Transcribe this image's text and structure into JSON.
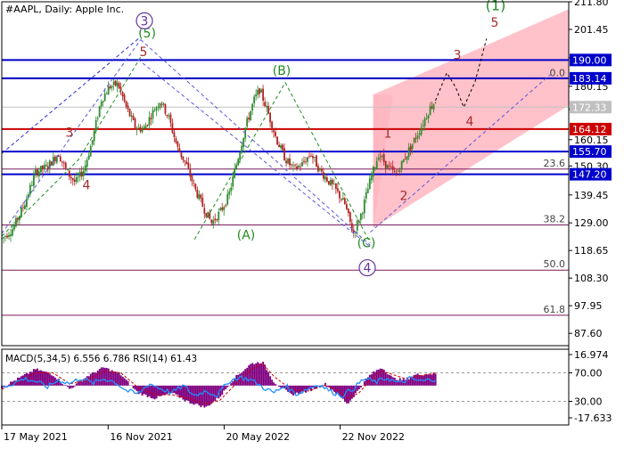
{
  "chart_data": [
    {
      "type": "candlestick",
      "title": "#AAPL, Daily:  Apple Inc.",
      "y_axis_ticks": [
        211.8,
        201.45,
        190.8,
        180.15,
        171.5,
        160.15,
        150.3,
        139.45,
        129.0,
        118.65,
        108.3,
        97.95,
        87.6
      ],
      "x_axis_ticks": [
        {
          "label": "17 May 2021",
          "t": 0
        },
        {
          "label": "16 Nov 2021",
          "t": 0.1876
        },
        {
          "label": "20 May 2022",
          "t": 0.3922
        },
        {
          "label": "22 Nov 2022",
          "t": 0.5968
        }
      ],
      "ylim": [
        87.6,
        211.8
      ],
      "price_path": [
        [
          0.0,
          123
        ],
        [
          0.02,
          127
        ],
        [
          0.04,
          136
        ],
        [
          0.06,
          148
        ],
        [
          0.08,
          150
        ],
        [
          0.1,
          155
        ],
        [
          0.115,
          148
        ],
        [
          0.13,
          144
        ],
        [
          0.145,
          149
        ],
        [
          0.16,
          160
        ],
        [
          0.175,
          175
        ],
        [
          0.19,
          180
        ],
        [
          0.205,
          181
        ],
        [
          0.22,
          172
        ],
        [
          0.235,
          165
        ],
        [
          0.25,
          164
        ],
        [
          0.265,
          170
        ],
        [
          0.28,
          175
        ],
        [
          0.295,
          168
        ],
        [
          0.31,
          157
        ],
        [
          0.325,
          151
        ],
        [
          0.34,
          142
        ],
        [
          0.355,
          135
        ],
        [
          0.37,
          129
        ],
        [
          0.385,
          133
        ],
        [
          0.4,
          139
        ],
        [
          0.415,
          152
        ],
        [
          0.43,
          165
        ],
        [
          0.445,
          175
        ],
        [
          0.455,
          179
        ],
        [
          0.47,
          170
        ],
        [
          0.485,
          160
        ],
        [
          0.5,
          153
        ],
        [
          0.515,
          149
        ],
        [
          0.53,
          151
        ],
        [
          0.545,
          155
        ],
        [
          0.56,
          149
        ],
        [
          0.575,
          145
        ],
        [
          0.59,
          141
        ],
        [
          0.605,
          136
        ],
        [
          0.62,
          125
        ],
        [
          0.635,
          133
        ],
        [
          0.65,
          145
        ],
        [
          0.665,
          155
        ],
        [
          0.68,
          150
        ],
        [
          0.695,
          147
        ],
        [
          0.71,
          153
        ],
        [
          0.725,
          159
        ],
        [
          0.74,
          165
        ],
        [
          0.755,
          172
        ],
        [
          0.765,
          174.8
        ]
      ],
      "current_price": 172.33,
      "horizontal_levels": [
        {
          "label": "190.00",
          "value": 190.0,
          "color": "#0000cc"
        },
        {
          "label": "183.14",
          "value": 183.14,
          "color": "#0000cc"
        },
        {
          "label": "164.12",
          "value": 164.12,
          "color": "#cc0000"
        },
        {
          "label": "155.70",
          "value": 155.7,
          "color": "#0000cc"
        },
        {
          "label": "147.20",
          "value": 147.2,
          "color": "#0000cc"
        }
      ],
      "fibonacci_levels": [
        {
          "label": "0.0",
          "value": 182.94
        },
        {
          "label": "23.6",
          "value": 149.13
        },
        {
          "label": "38.2",
          "value": 128.2
        },
        {
          "label": "50.0",
          "value": 111.28
        },
        {
          "label": "61.8",
          "value": 94.37
        }
      ],
      "wave_labels": [
        {
          "text": "3",
          "t": 0.0,
          "y": 161.2,
          "color": "#a52a2a",
          "circled": false
        },
        {
          "text": "4",
          "t": 0.0,
          "y": 141.5,
          "color": "#a52a2a",
          "circled": false
        },
        {
          "text": "5",
          "t": 0.0,
          "y": 191.5,
          "color": "#a52a2a",
          "circled": false
        },
        {
          "text": "(5)",
          "t": 0.0,
          "y": 198.4,
          "color": "#228b22",
          "circled": false
        },
        {
          "text": "3",
          "t": 0.0,
          "y": 203.0,
          "color": "#663399",
          "circled": true
        },
        {
          "text": "(A)",
          "t": 0.0,
          "y": 122.8,
          "color": "#228b22",
          "circled": false
        },
        {
          "text": "(B)",
          "t": 0.0,
          "y": 184.4,
          "color": "#228b22",
          "circled": false
        },
        {
          "text": "(C)",
          "t": 0.0,
          "y": 119.8,
          "color": "#228b22",
          "circled": false
        },
        {
          "text": "4",
          "t": 0.0,
          "y": 110.5,
          "color": "#663399",
          "circled": true
        },
        {
          "text": "1",
          "t": 0.0,
          "y": 160.9,
          "color": "#a52a2a",
          "circled": false
        },
        {
          "text": "2",
          "t": 0.0,
          "y": 137.5,
          "color": "#a52a2a",
          "circled": false
        },
        {
          "text": "3",
          "t": 0.0,
          "y": 190.3,
          "color": "#a52a2a",
          "circled": false
        },
        {
          "text": "4",
          "t": 0.0,
          "y": 165.4,
          "color": "#a52a2a",
          "circled": false
        },
        {
          "text": "5",
          "t": 0.0,
          "y": 202.5,
          "color": "#a52a2a",
          "circled": false
        },
        {
          "text": "(1)",
          "t": 0.0,
          "y": 208.6,
          "color": "#228b22",
          "circled": false
        }
      ],
      "forecast_path": [
        [
          0.765,
          174.8
        ],
        [
          0.785,
          185.2
        ],
        [
          0.8,
          180.0
        ],
        [
          0.815,
          172.3
        ],
        [
          0.835,
          182.0
        ],
        [
          0.855,
          198.0
        ]
      ],
      "channel": {
        "color": "#ffb6c1",
        "upper": [
          [
            0.655,
            177
          ],
          [
            1.0,
            209
          ]
        ],
        "lower": [
          [
            0.655,
            127
          ],
          [
            1.0,
            173
          ]
        ]
      }
    },
    {
      "type": "line",
      "title": "MACD(5,34,5) 6.556 6.786 RSI(14) 61.43",
      "y_axis_ticks": [
        "16.974",
        "70.00",
        "30.00",
        "-17.633"
      ],
      "ylim": [
        -17.633,
        16.974
      ],
      "rsi_levels": [
        70,
        30
      ],
      "series": [
        {
          "name": "MACD",
          "type": "histogram",
          "color": "#800080",
          "values": [
            [
              0,
              -1
            ],
            [
              0.03,
              4
            ],
            [
              0.06,
              9
            ],
            [
              0.09,
              6
            ],
            [
              0.12,
              -2
            ],
            [
              0.15,
              5
            ],
            [
              0.18,
              10
            ],
            [
              0.21,
              6
            ],
            [
              0.24,
              -4
            ],
            [
              0.27,
              -7
            ],
            [
              0.3,
              -4
            ],
            [
              0.33,
              -9
            ],
            [
              0.36,
              -12
            ],
            [
              0.385,
              -6
            ],
            [
              0.41,
              4
            ],
            [
              0.44,
              12
            ],
            [
              0.46,
              13
            ],
            [
              0.48,
              2
            ],
            [
              0.51,
              -5
            ],
            [
              0.54,
              -3
            ],
            [
              0.57,
              1
            ],
            [
              0.59,
              -4
            ],
            [
              0.61,
              -10
            ],
            [
              0.63,
              -2
            ],
            [
              0.65,
              6
            ],
            [
              0.67,
              10
            ],
            [
              0.69,
              4
            ],
            [
              0.71,
              3
            ],
            [
              0.73,
              6
            ],
            [
              0.765,
              6.556
            ]
          ]
        },
        {
          "name": "Signal",
          "type": "line",
          "color": "#cc0000",
          "dashed": true,
          "values": [
            [
              0,
              -2
            ],
            [
              0.03,
              2
            ],
            [
              0.06,
              7
            ],
            [
              0.09,
              7
            ],
            [
              0.12,
              1
            ],
            [
              0.15,
              3
            ],
            [
              0.18,
              8
            ],
            [
              0.21,
              7
            ],
            [
              0.24,
              -1
            ],
            [
              0.27,
              -5
            ],
            [
              0.3,
              -5
            ],
            [
              0.33,
              -7
            ],
            [
              0.36,
              -10
            ],
            [
              0.385,
              -8
            ],
            [
              0.41,
              0
            ],
            [
              0.44,
              9
            ],
            [
              0.46,
              12
            ],
            [
              0.48,
              5
            ],
            [
              0.51,
              -2
            ],
            [
              0.54,
              -3
            ],
            [
              0.57,
              0
            ],
            [
              0.59,
              -2
            ],
            [
              0.61,
              -7
            ],
            [
              0.63,
              -4
            ],
            [
              0.65,
              3
            ],
            [
              0.67,
              8
            ],
            [
              0.69,
              6
            ],
            [
              0.71,
              4
            ],
            [
              0.73,
              5
            ],
            [
              0.765,
              6.786
            ]
          ]
        },
        {
          "name": "RSI",
          "type": "line",
          "color": "#1e90ff",
          "values": [
            [
              0,
              50
            ],
            [
              0.02,
              55
            ],
            [
              0.04,
              62
            ],
            [
              0.06,
              58
            ],
            [
              0.08,
              50
            ],
            [
              0.1,
              60
            ],
            [
              0.12,
              55
            ],
            [
              0.14,
              63
            ],
            [
              0.16,
              55
            ],
            [
              0.18,
              62
            ],
            [
              0.2,
              57
            ],
            [
              0.22,
              45
            ],
            [
              0.24,
              40
            ],
            [
              0.26,
              55
            ],
            [
              0.28,
              48
            ],
            [
              0.3,
              42
            ],
            [
              0.32,
              52
            ],
            [
              0.34,
              38
            ],
            [
              0.36,
              45
            ],
            [
              0.38,
              38
            ],
            [
              0.4,
              58
            ],
            [
              0.42,
              64
            ],
            [
              0.44,
              60
            ],
            [
              0.46,
              50
            ],
            [
              0.48,
              42
            ],
            [
              0.5,
              52
            ],
            [
              0.52,
              40
            ],
            [
              0.54,
              48
            ],
            [
              0.56,
              54
            ],
            [
              0.58,
              44
            ],
            [
              0.6,
              38
            ],
            [
              0.62,
              48
            ],
            [
              0.64,
              62
            ],
            [
              0.66,
              57
            ],
            [
              0.68,
              63
            ],
            [
              0.7,
              55
            ],
            [
              0.72,
              62
            ],
            [
              0.74,
              58
            ],
            [
              0.765,
              61.43
            ]
          ]
        }
      ]
    }
  ]
}
